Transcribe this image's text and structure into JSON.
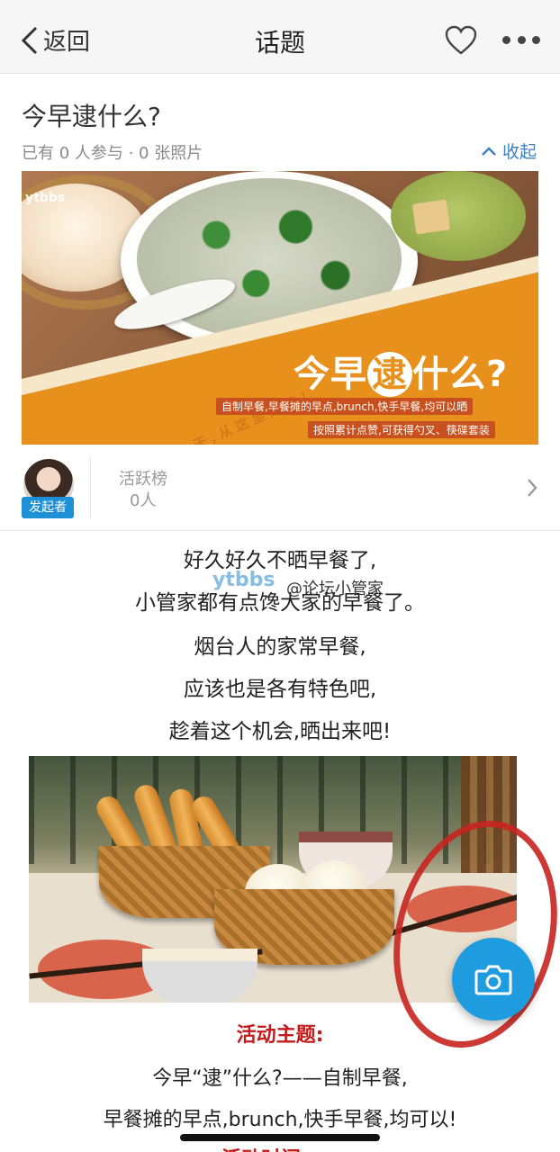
{
  "nav": {
    "back_label": "返回",
    "title": "话题"
  },
  "topic": {
    "title": "今早逮什么?",
    "meta": "已有 0 人参与 · 0 张照片",
    "collapse_label": "收起"
  },
  "banner": {
    "logo": "ytbbs",
    "slogan": "烟台人的一天,从这里开始!",
    "headline_pre": "今早",
    "headline_highlight": "逮",
    "headline_post": "什么?",
    "line1": "自制早餐,早餐摊的早点,brunch,快手早餐,均可以晒",
    "line2": "按照累计点赞,可获得勺叉、筷碟套装"
  },
  "initiator": {
    "badge": "发起者",
    "rank_label": "活跃榜",
    "rank_count": "0人"
  },
  "post": {
    "lines": [
      "好久好久不晒早餐了,",
      "小管家都有点馋大家的早餐了。",
      "烟台人的家常早餐,",
      "应该也是各有特色吧,",
      "趁着这个机会,晒出来吧!"
    ],
    "watermark": "ytbbs",
    "watermark_user": "@论坛小管家"
  },
  "activity": {
    "heading": "活动主题:",
    "lines": [
      "今早“逮”什么?——自制早餐,",
      "早餐摊的早点,brunch,快手早餐,均可以!"
    ],
    "next_heading": "活动时间:"
  },
  "colors": {
    "accent_blue": "#1f9be0",
    "activity_red": "#c41a1a",
    "banner_orange": "#e8901c"
  }
}
